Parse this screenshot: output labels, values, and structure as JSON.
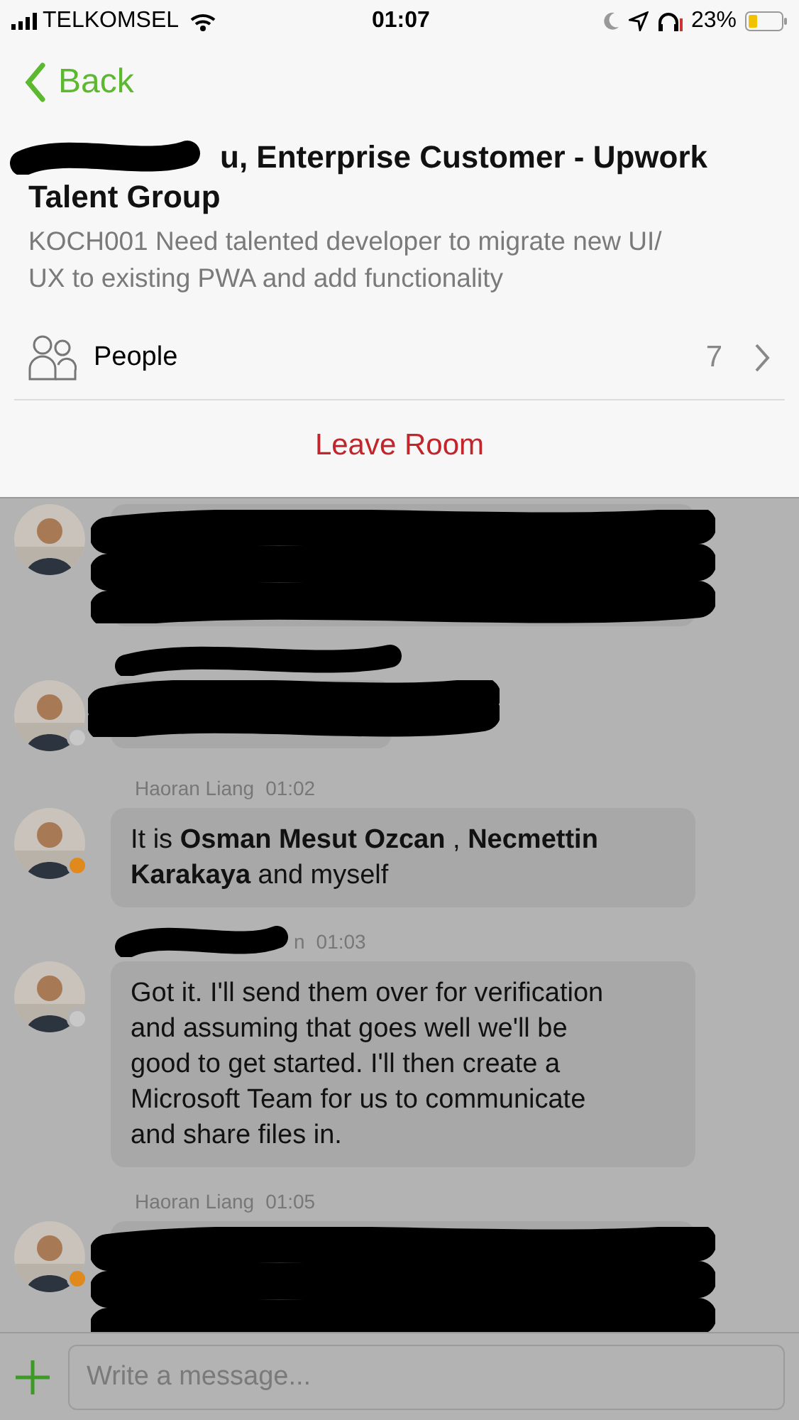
{
  "status_bar": {
    "carrier": "TELKOMSEL",
    "time": "01:07",
    "battery": "23%"
  },
  "nav": {
    "back": "Back"
  },
  "room": {
    "title_lines": [
      "u, Enterprise Customer - Upwork",
      "Talent Group"
    ],
    "title_redacted": true,
    "description": "KOCH001 Need talented developer to migrate new UI/ UX to existing PWA and add functionality"
  },
  "people": {
    "label": "People",
    "count": "7"
  },
  "leave": "Leave Room",
  "messages": [
    {
      "kind": "redacted"
    },
    {
      "kind": "redacted-short",
      "meta_redacted": true,
      "color": "#c8c8c8"
    },
    {
      "kind": "text",
      "sender": "Haoran Liang",
      "time": "01:02",
      "color": "#e08a1e",
      "text": "It is **Osman Mesut Ozcan** , **Necmettin Karakaya** and myself"
    },
    {
      "kind": "text",
      "sender": "n",
      "sender_redacted": true,
      "time": "01:03",
      "color": "#c8c8c8",
      "text": "Got it. I'll send them over for verification and assuming that goes well we'll be good to get started. I'll then create a Microsoft Team for us to communicate and share files in."
    },
    {
      "kind": "redacted",
      "sender": "Haoran Liang",
      "time": "01:05",
      "color": "#e08a1e"
    }
  ],
  "composer": {
    "placeholder": "Write a message..."
  }
}
